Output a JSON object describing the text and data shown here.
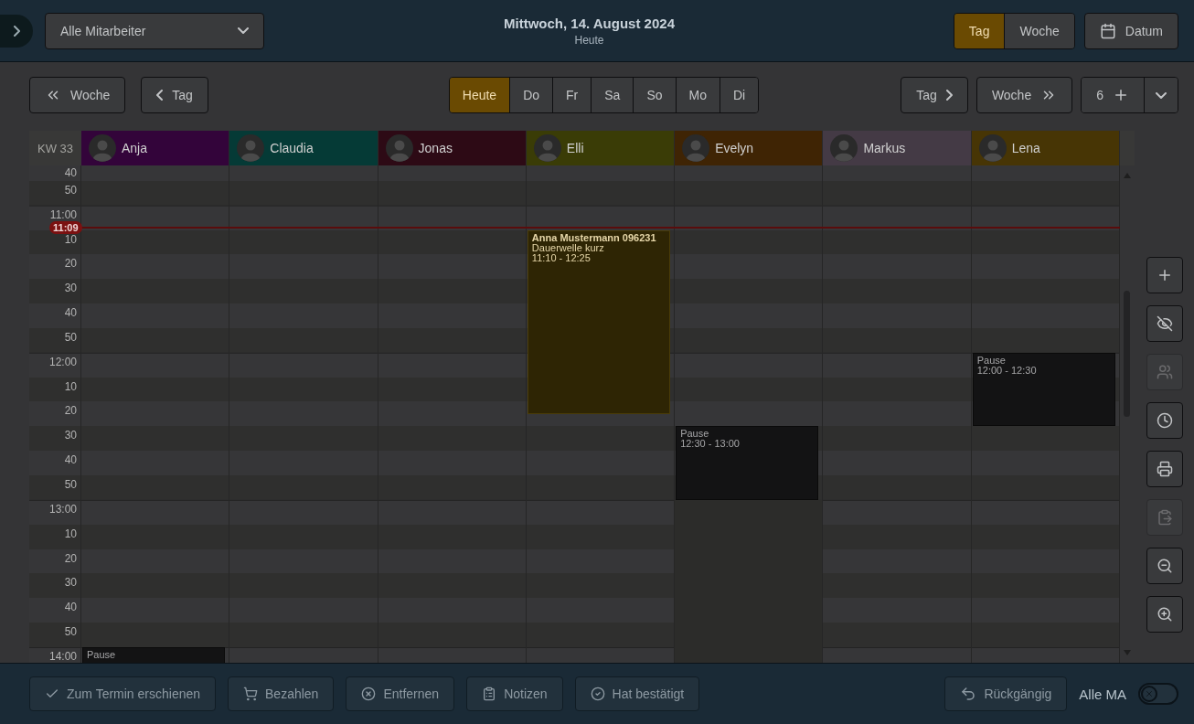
{
  "header": {
    "employee_select": {
      "value": "Alle Mitarbeiter"
    },
    "title": "Mittwoch, 14. August 2024",
    "subtitle": "Heute",
    "view_toggle": [
      {
        "label": "Tag",
        "selected": true
      },
      {
        "label": "Woche",
        "selected": false
      }
    ],
    "date_button": "Datum"
  },
  "toolbar": {
    "back_buttons": [
      {
        "label": "Woche",
        "kind": "double"
      },
      {
        "label": "Tag",
        "kind": "single"
      }
    ],
    "days": [
      {
        "label": "Heute",
        "selected": true
      },
      {
        "label": "Do",
        "selected": false
      },
      {
        "label": "Fr",
        "selected": false
      },
      {
        "label": "Sa",
        "selected": false
      },
      {
        "label": "So",
        "selected": false
      },
      {
        "label": "Mo",
        "selected": false
      },
      {
        "label": "Di",
        "selected": false
      }
    ],
    "forward_buttons": [
      {
        "label": "Tag",
        "kind": "single"
      },
      {
        "label": "Woche",
        "kind": "double"
      }
    ],
    "count": "6"
  },
  "calendar": {
    "week_label": "KW 33",
    "time_rows": [
      "40",
      "50",
      "11:00",
      "10",
      "20",
      "30",
      "40",
      "50",
      "12:00",
      "10",
      "20",
      "30",
      "40",
      "50",
      "13:00",
      "10",
      "20",
      "30",
      "40",
      "50",
      "14:00"
    ],
    "now": {
      "label": "11:09"
    },
    "employees": [
      {
        "name": "Anja",
        "color": "#33043a",
        "events": [
          {
            "kind": "pause",
            "title": "Pause"
          }
        ]
      },
      {
        "name": "Claudia",
        "color": "#053a36"
      },
      {
        "name": "Jonas",
        "color": "#2d0a15"
      },
      {
        "name": "Elli",
        "color": "#3a3c06",
        "events": [
          {
            "kind": "appointment",
            "title": "Anna Mustermann  096231",
            "service": "Dauerwelle kurz",
            "time": "11:10 - 12:25"
          }
        ]
      },
      {
        "name": "Evelyn",
        "color": "#3f2404",
        "events": [
          {
            "kind": "pause",
            "title": "Pause",
            "time": "12:30 - 13:00"
          },
          {
            "kind": "unavailable"
          }
        ]
      },
      {
        "name": "Markus",
        "color": "#443a45"
      },
      {
        "name": "Lena",
        "color": "#473505",
        "events": [
          {
            "kind": "pause",
            "title": "Pause",
            "time": "12:00 - 12:30"
          }
        ]
      }
    ]
  },
  "side_tools": [
    {
      "kind": "add",
      "disabled": false
    },
    {
      "kind": "hide",
      "disabled": false
    },
    {
      "kind": "group",
      "disabled": true
    },
    {
      "kind": "clock",
      "disabled": false
    },
    {
      "kind": "print",
      "disabled": false
    },
    {
      "kind": "paste",
      "disabled": true
    },
    {
      "kind": "zoom-out",
      "disabled": false
    },
    {
      "kind": "zoom-in",
      "disabled": false
    }
  ],
  "actions": [
    {
      "label": "Zum Termin erschienen",
      "kind": "check",
      "disabled": true
    },
    {
      "label": "Bezahlen",
      "kind": "cart",
      "disabled": true
    },
    {
      "label": "Entfernen",
      "kind": "remove",
      "disabled": true
    },
    {
      "label": "Notizen",
      "kind": "notes",
      "disabled": true
    },
    {
      "label": "Hat bestätigt",
      "kind": "confirmed",
      "disabled": true
    }
  ],
  "undo": {
    "label": "Rückgängig",
    "disabled": true
  },
  "all_toggle": {
    "label": "Alle MA",
    "on": false
  }
}
